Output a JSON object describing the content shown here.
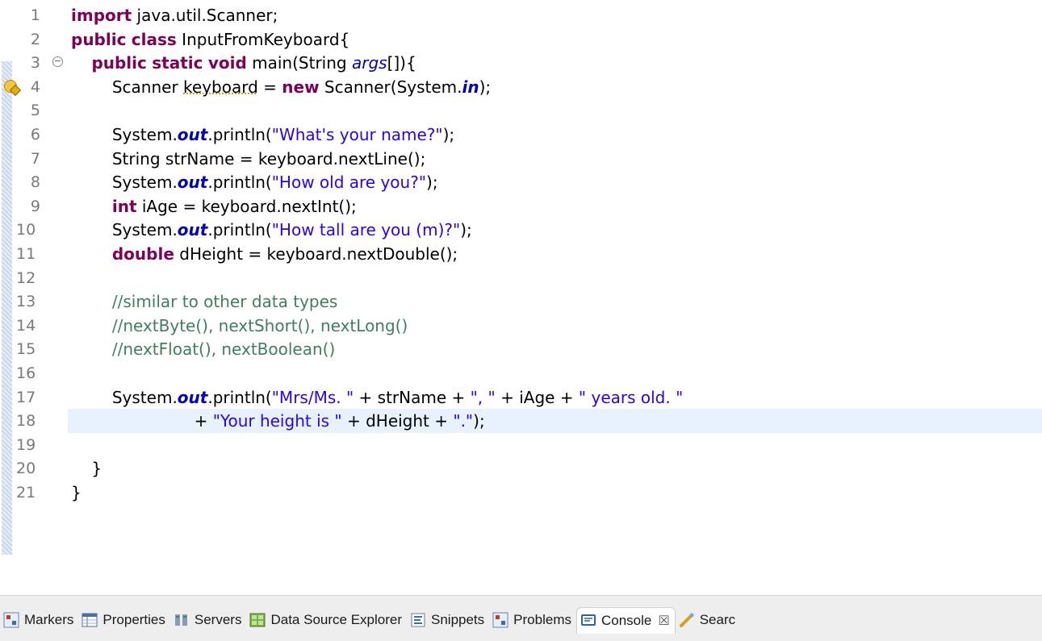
{
  "editor": {
    "current_line": 18,
    "lines": [
      {
        "n": "1",
        "tokens": [
          {
            "t": "import",
            "c": "kw"
          },
          {
            "t": " java.util.Scanner;"
          }
        ]
      },
      {
        "n": "2",
        "tokens": [
          {
            "t": "public",
            "c": "kw"
          },
          {
            "t": " "
          },
          {
            "t": "class",
            "c": "kw"
          },
          {
            "t": " InputFromKeyboard{"
          }
        ]
      },
      {
        "n": "3",
        "fold": true,
        "tokens": [
          {
            "t": "    "
          },
          {
            "t": "public",
            "c": "kw"
          },
          {
            "t": " "
          },
          {
            "t": "static",
            "c": "kw"
          },
          {
            "t": " "
          },
          {
            "t": "void",
            "c": "kw"
          },
          {
            "t": " main(String "
          },
          {
            "t": "args",
            "c": "sfld"
          },
          {
            "t": "[]){"
          }
        ]
      },
      {
        "n": "4",
        "warning": true,
        "tokens": [
          {
            "t": "        Scanner "
          },
          {
            "t": "keyboard",
            "c": "wv"
          },
          {
            "t": " = "
          },
          {
            "t": "new",
            "c": "kw"
          },
          {
            "t": " Scanner(System."
          },
          {
            "t": "in",
            "c": "fld"
          },
          {
            "t": ");"
          }
        ]
      },
      {
        "n": "5",
        "tokens": []
      },
      {
        "n": "6",
        "tokens": [
          {
            "t": "        System."
          },
          {
            "t": "out",
            "c": "fld"
          },
          {
            "t": ".println("
          },
          {
            "t": "\"What's your name?\"",
            "c": "str"
          },
          {
            "t": ");"
          }
        ]
      },
      {
        "n": "7",
        "tokens": [
          {
            "t": "        String strName = keyboard.nextLine();"
          }
        ]
      },
      {
        "n": "8",
        "tokens": [
          {
            "t": "        System."
          },
          {
            "t": "out",
            "c": "fld"
          },
          {
            "t": ".println("
          },
          {
            "t": "\"How old are you?\"",
            "c": "str"
          },
          {
            "t": ");"
          }
        ]
      },
      {
        "n": "9",
        "tokens": [
          {
            "t": "        "
          },
          {
            "t": "int",
            "c": "kw"
          },
          {
            "t": " iAge = keyboard.nextInt();"
          }
        ]
      },
      {
        "n": "10",
        "tokens": [
          {
            "t": "        System."
          },
          {
            "t": "out",
            "c": "fld"
          },
          {
            "t": ".println("
          },
          {
            "t": "\"How tall are you (m)?\"",
            "c": "str"
          },
          {
            "t": ");"
          }
        ]
      },
      {
        "n": "11",
        "tokens": [
          {
            "t": "        "
          },
          {
            "t": "double",
            "c": "kw"
          },
          {
            "t": " dHeight = keyboard.nextDouble();"
          }
        ]
      },
      {
        "n": "12",
        "tokens": []
      },
      {
        "n": "13",
        "tokens": [
          {
            "t": "        "
          },
          {
            "t": "//similar to other data types",
            "c": "cm"
          }
        ]
      },
      {
        "n": "14",
        "tokens": [
          {
            "t": "        "
          },
          {
            "t": "//nextByte(), nextShort(), nextLong()",
            "c": "cm"
          }
        ]
      },
      {
        "n": "15",
        "tokens": [
          {
            "t": "        "
          },
          {
            "t": "//nextFloat(), nextBoolean()",
            "c": "cm"
          }
        ]
      },
      {
        "n": "16",
        "tokens": []
      },
      {
        "n": "17",
        "tokens": [
          {
            "t": "        System."
          },
          {
            "t": "out",
            "c": "fld"
          },
          {
            "t": ".println("
          },
          {
            "t": "\"Mrs/Ms. \"",
            "c": "str"
          },
          {
            "t": " + strName + "
          },
          {
            "t": "\", \"",
            "c": "str"
          },
          {
            "t": " + iAge + "
          },
          {
            "t": "\" years old. \"",
            "c": "str"
          }
        ]
      },
      {
        "n": "18",
        "tokens": [
          {
            "t": "                        + "
          },
          {
            "t": "\"Your height is \"",
            "c": "str"
          },
          {
            "t": " + dHeight + "
          },
          {
            "t": "\".\"",
            "c": "str"
          },
          {
            "t": ");"
          }
        ]
      },
      {
        "n": "19",
        "tokens": []
      },
      {
        "n": "20",
        "tokens": [
          {
            "t": "    }"
          }
        ]
      },
      {
        "n": "21",
        "tokens": [
          {
            "t": "}"
          }
        ]
      }
    ]
  },
  "tabs": [
    {
      "name": "markers",
      "label": "Markers",
      "icon": "markers-icon"
    },
    {
      "name": "properties",
      "label": "Properties",
      "icon": "properties-icon"
    },
    {
      "name": "servers",
      "label": "Servers",
      "icon": "servers-icon"
    },
    {
      "name": "data-source-explorer",
      "label": "Data Source Explorer",
      "icon": "data-source-explorer-icon"
    },
    {
      "name": "snippets",
      "label": "Snippets",
      "icon": "snippets-icon"
    },
    {
      "name": "problems",
      "label": "Problems",
      "icon": "problems-icon"
    },
    {
      "name": "console",
      "label": "Console",
      "icon": "console-icon",
      "active": true,
      "close": "☒"
    },
    {
      "name": "search",
      "label": "Searc",
      "icon": "search-icon"
    }
  ]
}
